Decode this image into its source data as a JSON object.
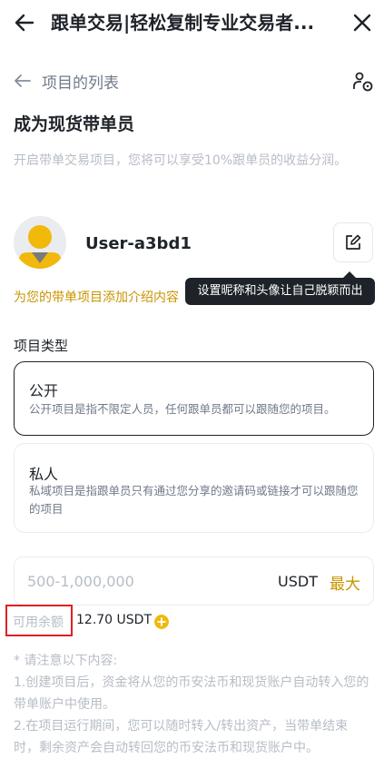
{
  "header": {
    "title": "跟单交易|轻松复制专业交易者..."
  },
  "breadcrumb": {
    "label": "项目的列表"
  },
  "page": {
    "heading": "成为现货带单员",
    "intro": "开启带单交易项目，您将可以享受10%跟单员的收益分润。"
  },
  "profile": {
    "username": "User-a3bd1",
    "tooltip": "设置昵称和头像让自己脱颖而出",
    "add_intro_link": "为您的带单项目添加介绍内容"
  },
  "project_type": {
    "label": "项目类型",
    "options": [
      {
        "title": "公开",
        "description": "公开项目是指不限定人员，任何跟单员都可以跟随您的项目。",
        "selected": true
      },
      {
        "title": "私人",
        "description": "私域项目是指跟单员只有通过您分享的邀请码或链接才可以跟随您的项目",
        "selected": false
      }
    ]
  },
  "amount": {
    "placeholder": "500-1,000,000",
    "unit": "USDT",
    "max_label": "最大"
  },
  "balance": {
    "label": "可用余额",
    "value": "12.70 USDT"
  },
  "notes": {
    "title": "* 请注意以下内容:",
    "items": [
      "1.创建项目后，资金将从您的币安法币和现货账户自动转入您的带单账户中使用。",
      "2.在项目运行期间，您可以随时转入/转出资产，当带单结束时，剩余资产会自动转回您的币安法币和现货账户中。"
    ]
  },
  "colors": {
    "accent": "#c99400",
    "brand_yellow": "#f0b90b",
    "highlight_box": "#e02020"
  }
}
